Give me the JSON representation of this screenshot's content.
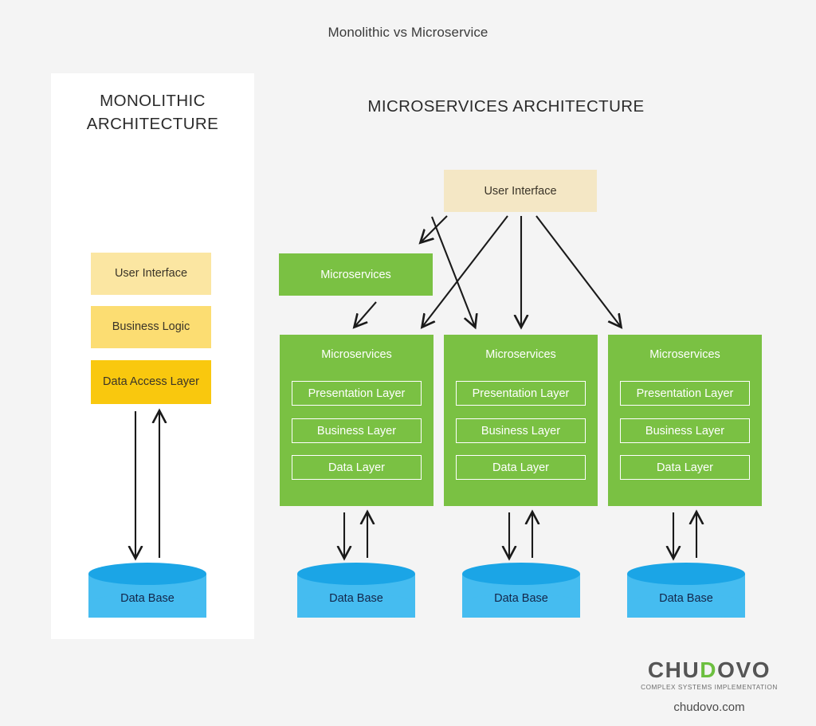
{
  "page": {
    "title": "Monolithic vs Microservice",
    "background_color": "#f4f4f4"
  },
  "colors": {
    "green": "#7ac143",
    "cream": "#f4e7c5",
    "yellow_light": "#fbe6a2",
    "yellow_mid": "#fcdd72",
    "yellow_strong": "#f9c80e",
    "db_top": "#1ba5e6",
    "db_body": "#45bcf0",
    "db_text": "#13264a",
    "arrow": "#1a1a1a",
    "panel": "#ffffff"
  },
  "monolithic": {
    "heading_line1": "MONOLITHIC",
    "heading_line2": "ARCHITECTURE",
    "layers": [
      {
        "label": "User Interface",
        "color": "#fbe6a2"
      },
      {
        "label": "Business Logic",
        "color": "#fcdd72"
      },
      {
        "label": "Data Access Layer",
        "color": "#f9c80e"
      }
    ],
    "database": {
      "label": "Data Base"
    }
  },
  "microservices": {
    "heading": "MICROSERVICES ARCHITECTURE",
    "user_interface": {
      "label": "User Interface"
    },
    "gateway_service": {
      "label": "Microservices"
    },
    "columns": [
      {
        "title": "Microservices",
        "layers": [
          "Presentation Layer",
          "Business Layer",
          "Data Layer"
        ],
        "database": "Data Base"
      },
      {
        "title": "Microservices",
        "layers": [
          "Presentation Layer",
          "Business Layer",
          "Data Layer"
        ],
        "database": "Data Base"
      },
      {
        "title": "Microservices",
        "layers": [
          "Presentation Layer",
          "Business Layer",
          "Data Layer"
        ],
        "database": "Data Base"
      }
    ]
  },
  "branding": {
    "name_part1": "CHU",
    "name_part2": "D",
    "name_part3": "OVO",
    "tagline": "COMPLEX SYSTEMS IMPLEMENTATION",
    "website": "chudovo.com"
  }
}
